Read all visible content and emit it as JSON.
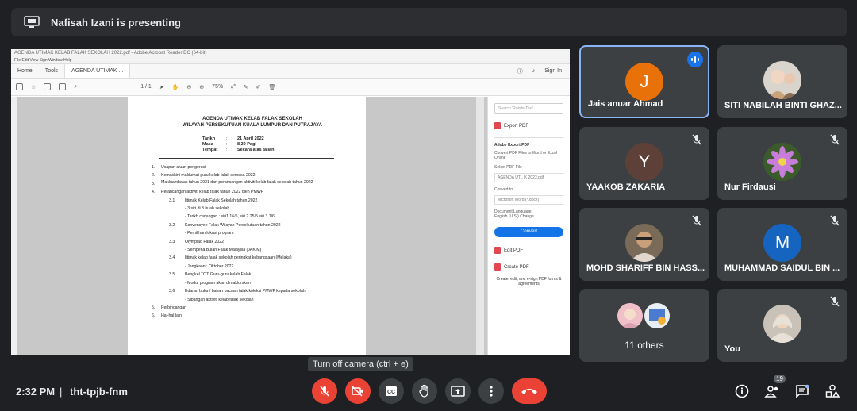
{
  "banner": {
    "presenting_text": "Nafisah Izani is presenting"
  },
  "shared_screen": {
    "window_title": "AGENDA UTIMAK KELAB FALAK SEKOLAH 2022.pdf - Adobe Acrobat Reader DC (64-bit)",
    "menu": "File   Edit   View   Sign   Window   Help",
    "tabs": [
      "Home",
      "Tools",
      "AGENDA UTIMAK ..."
    ],
    "sign_in": "Sign In",
    "page_indicator": "1 / 1",
    "zoom": "75%",
    "doc": {
      "title1": "AGENDA UTIMAK KELAB FALAK SEKOLAH",
      "title2": "WILAYAH PERSEKUTUAN KUALA LUMPUR DAN PUTRAJAYA",
      "meta": [
        {
          "k": "Tarikh",
          "v": "21 April 2022"
        },
        {
          "k": "Masa",
          "v": "8.30 Pagi"
        },
        {
          "k": "Tempat",
          "v": "Secara atas talian"
        }
      ],
      "items": [
        {
          "n": "1.",
          "t": "Ucapan aluan pengerusi"
        },
        {
          "n": "2.",
          "t": "Kemaskini maklumat guru kelab falak semasa 2022"
        },
        {
          "n": "3.",
          "t": "Makluambalas tahun 2021 dan perancangan aktiviti kelab falak sekolah tahun 2022"
        },
        {
          "n": "4.",
          "t": "Perancangan aktiviti kelab falak tahun 2022 oleh PMWP"
        }
      ],
      "subitems": [
        {
          "n": "3.1",
          "t": "Ijtimak Kelab Falak Sekolah tahun 2022",
          "notes": [
            "- 3 siri di 3 buah sekolah",
            "- Tarikh cadangan : siri1 16/5, siri 2 25/5 siri 3 1/6"
          ]
        },
        {
          "n": "3.2",
          "t": "Konvensyen Falak Wilayah Persekutuan tahun 2022",
          "notes": [
            "- Pemilihan lokasi program"
          ]
        },
        {
          "n": "3.3",
          "t": "Olympiad Falak 2022",
          "notes": [
            "- Sempena Bulan Falak Malaysia (JAKIM)"
          ]
        },
        {
          "n": "3.4",
          "t": "Ijtimak kelab falak sekolah peringkat kebangsaan (Melaka)",
          "notes": [
            "- Jangkaan : Oktober 2022"
          ]
        },
        {
          "n": "3.5",
          "t": "Bengkel TOT Guru-guru kelab Falak",
          "notes": [
            "- Modul program akan dimaklumkan"
          ]
        },
        {
          "n": "3.6",
          "t": "Edaran buku / bahan bacaan falak koleksi PMWP kepada sekolah",
          "notes": [
            "- Sibangan aktiviti kelab falak sekolah"
          ]
        }
      ],
      "tail": [
        {
          "n": "5.",
          "t": "Perbincangan"
        },
        {
          "n": "6.",
          "t": "Hal-hal lain"
        }
      ]
    },
    "side_panel": {
      "search_placeholder": "Search 'Rotate Text'",
      "export_label": "Export PDF",
      "adobe_export": "Adobe Export PDF",
      "desc": "Convert PDF Files to Word or Excel Online",
      "select_label": "Select PDF File",
      "file_name": "AGENDA UT...IK 2022.pdf",
      "convert_to": "Convert to",
      "format": "Microsoft Word (*.docx)",
      "doc_lang_label": "Document Language:",
      "doc_lang": "English (U.S.) Change",
      "convert_btn": "Convert",
      "edit_pdf": "Edit PDF",
      "create_pdf": "Create PDF",
      "promo": "Create, edit, and e-sign PDF forms & agreements"
    }
  },
  "participants": [
    {
      "name": "Jais anuar Ahmad",
      "initial": "J",
      "color": "#e8710a",
      "speaking": true
    },
    {
      "name": "SITI NABILAH BINTI GHAZ...",
      "photo": true
    },
    {
      "name": "YAAKOB ZAKARIA",
      "initial": "Y",
      "color": "#5d4037",
      "muted": true
    },
    {
      "name": "Nur Firdausi",
      "photo": true,
      "muted": true
    },
    {
      "name": "MOHD SHARIFF BIN HASS...",
      "photo": true,
      "muted": true
    },
    {
      "name": "MUHAMMAD SAIDUL BIN ...",
      "initial": "M",
      "color": "#1565c0",
      "muted": true
    },
    {
      "name": "11 others"
    },
    {
      "name": "You",
      "photo": true,
      "muted": true
    }
  ],
  "tooltip": "Turn off camera (ctrl + e)",
  "bottom": {
    "time": "2:32 PM",
    "divider": "|",
    "meeting_code": "tht-tpjb-fnm",
    "people_count": "19"
  },
  "icons": {
    "present": "presentation-icon",
    "mic": "mic-off-icon",
    "cam": "camera-off-icon",
    "cc": "captions-icon",
    "hand": "raise-hand-icon",
    "present_btn": "present-now-icon",
    "more": "more-vert-icon",
    "hangup": "call-end-icon",
    "info": "info-icon",
    "people": "people-icon",
    "chat": "chat-icon",
    "activities": "activities-icon"
  }
}
